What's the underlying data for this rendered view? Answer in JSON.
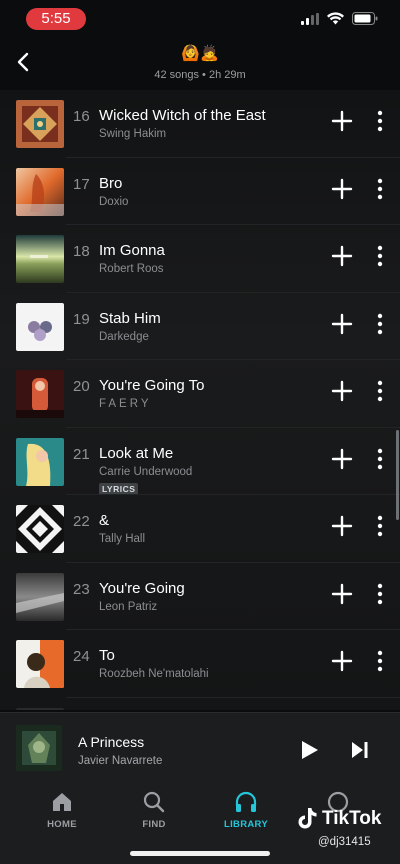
{
  "status_bar": {
    "time": "5:55"
  },
  "header": {
    "emoji": "🙆🙇",
    "subtitle": "42 songs • 2h 29m"
  },
  "tracks": [
    {
      "num": "16",
      "title": "Wicked Witch of the East",
      "artist": "Swing Hakim",
      "lyrics": ""
    },
    {
      "num": "17",
      "title": "Bro",
      "artist": "Doxio",
      "lyrics": ""
    },
    {
      "num": "18",
      "title": "Im Gonna",
      "artist": "Robert Roos",
      "lyrics": ""
    },
    {
      "num": "19",
      "title": "Stab Him",
      "artist": "Darkedge",
      "lyrics": ""
    },
    {
      "num": "20",
      "title": "You're Going To",
      "artist": "FAERY",
      "lyrics": ""
    },
    {
      "num": "21",
      "title": "Look at Me",
      "artist": "Carrie Underwood",
      "lyrics": "LYRICS"
    },
    {
      "num": "22",
      "title": "&",
      "artist": "Tally Hall",
      "lyrics": ""
    },
    {
      "num": "23",
      "title": "You're Going",
      "artist": "Leon Patriz",
      "lyrics": ""
    },
    {
      "num": "24",
      "title": "To",
      "artist": "Roozbeh Ne'matolahi",
      "lyrics": ""
    }
  ],
  "now_playing": {
    "title": "A Princess",
    "artist": "Javier Navarrete"
  },
  "tabs": [
    {
      "label": "HOME",
      "icon": "home-icon",
      "active": false
    },
    {
      "label": "FIND",
      "icon": "search-icon",
      "active": false
    },
    {
      "label": "LIBRARY",
      "icon": "headphones-icon",
      "active": true
    },
    {
      "label": "",
      "icon": "profile-icon",
      "active": false
    }
  ],
  "watermark": {
    "brand": "TikTok",
    "user": "@dj31415"
  },
  "colors": {
    "accent": "#25c6da",
    "status_pill": "#e03a3e"
  }
}
